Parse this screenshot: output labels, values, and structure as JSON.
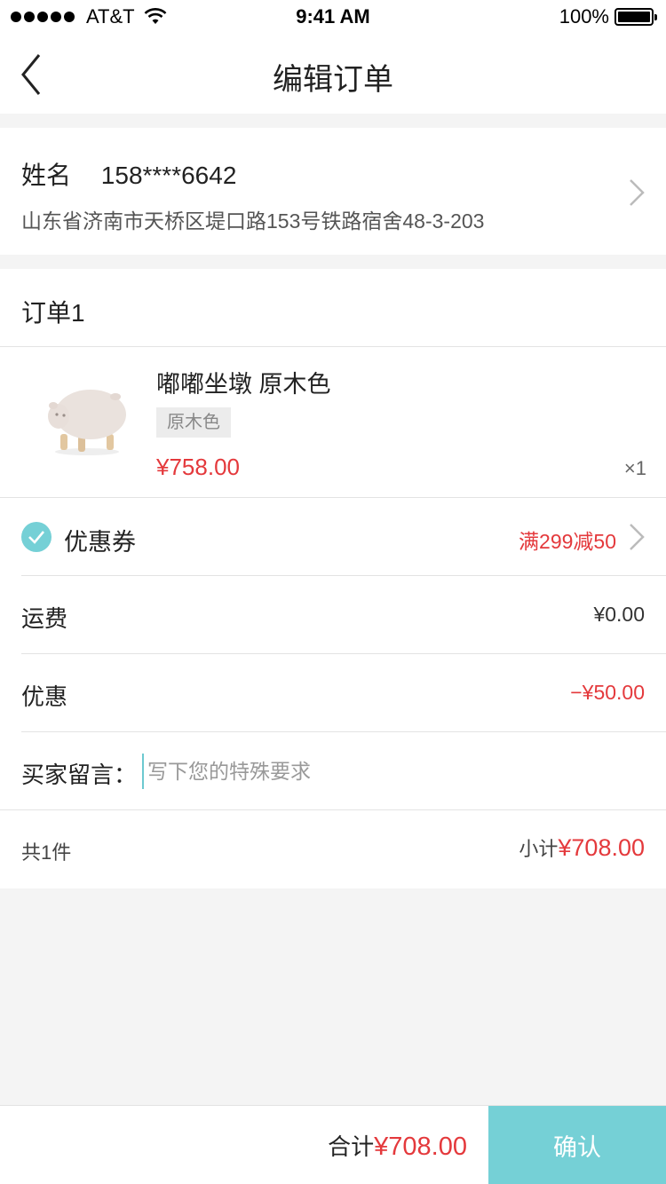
{
  "status_bar": {
    "carrier": "AT&T",
    "time": "9:41 AM",
    "battery": "100%"
  },
  "nav": {
    "title": "编辑订单",
    "back_icon": "chevron-left-icon"
  },
  "address": {
    "name": "姓名",
    "phone": "158****6642",
    "detail": "山东省济南市天桥区堤口路153号铁路宿舍48-3-203"
  },
  "order": {
    "title": "订单1",
    "product": {
      "name": "嘟嘟坐墩 原木色",
      "variant": "原木色",
      "price": "¥758.00",
      "qty": "×1"
    },
    "coupon": {
      "label": "优惠券",
      "value": "满299减50",
      "checked": true
    },
    "shipping": {
      "label": "运费",
      "value": "¥0.00"
    },
    "discount": {
      "label": "优惠",
      "value": "−¥50.00"
    },
    "message": {
      "label": "买家留言：",
      "placeholder": "写下您的特殊要求",
      "value": ""
    },
    "summary": {
      "count": "共1件",
      "subtotal_label": "小计",
      "subtotal_value": "¥708.00"
    }
  },
  "bottom": {
    "total_label": "合计",
    "total_value": "¥708.00",
    "confirm_label": "确认"
  },
  "colors": {
    "accent": "#75d0d6",
    "price_red": "#e4393c",
    "background": "#f4f4f4"
  }
}
